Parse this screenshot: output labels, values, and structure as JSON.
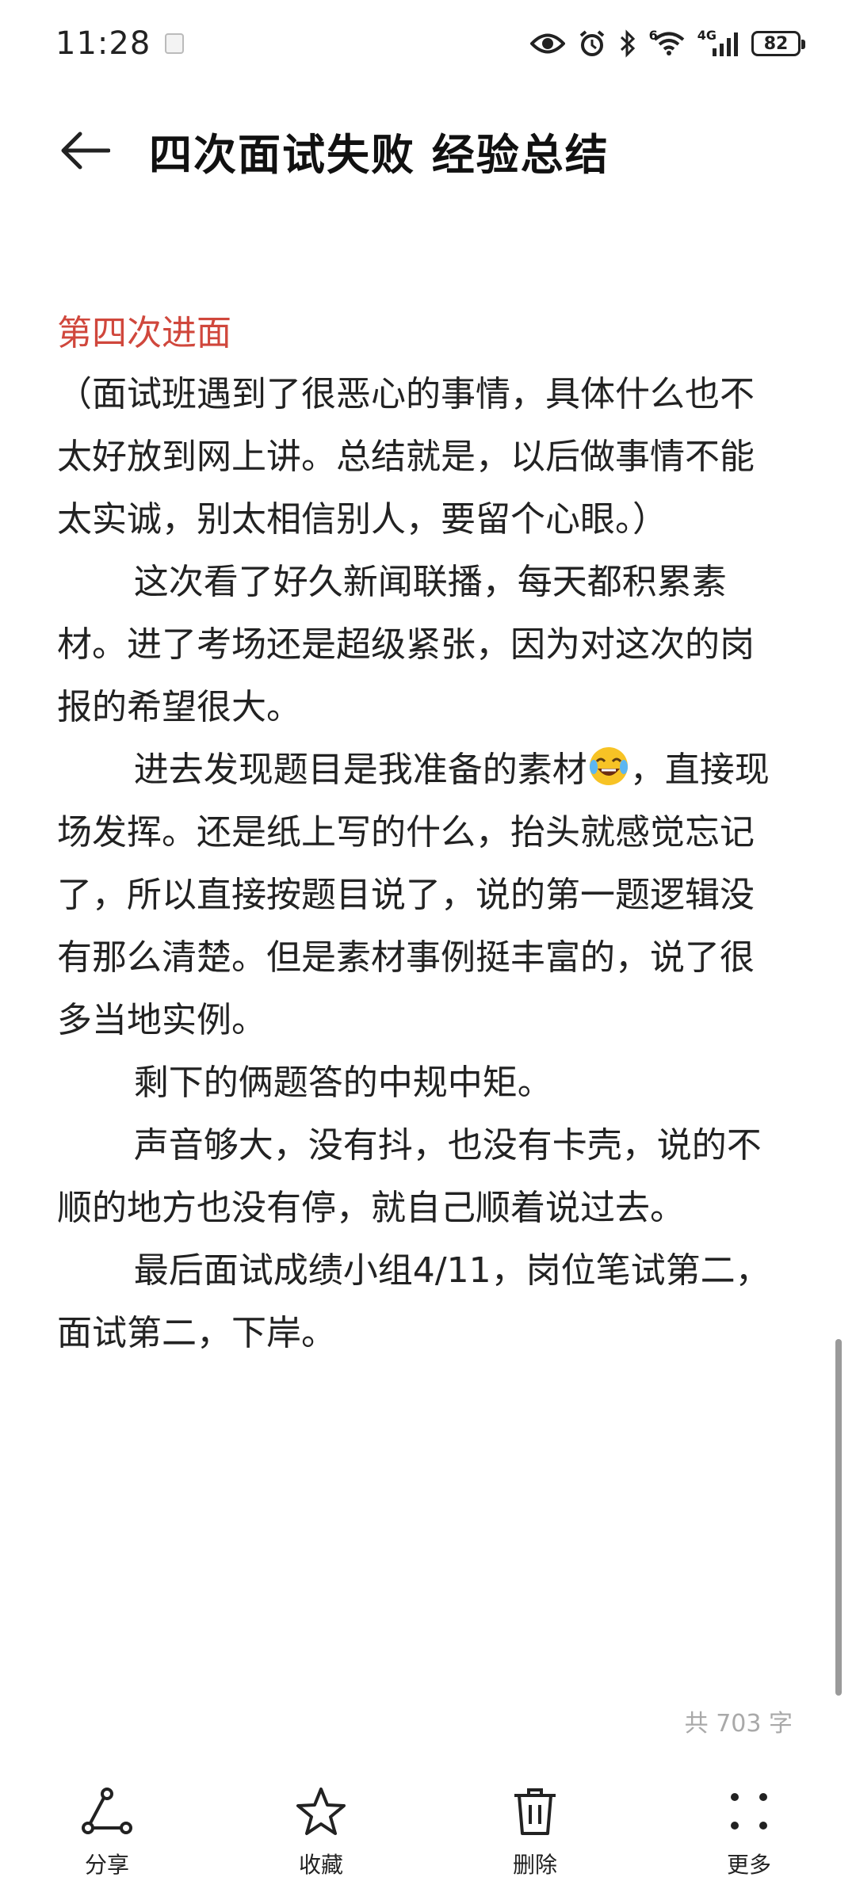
{
  "status_bar": {
    "time": "11:28",
    "network_label": "4G",
    "signal_superscript": "6",
    "battery": "82",
    "icons": [
      "eye-icon",
      "alarm-icon",
      "bluetooth-icon",
      "wifi-icon",
      "signal-icon",
      "battery-icon"
    ]
  },
  "header": {
    "title": "四次面试失败 经验总结",
    "back_icon": "back-arrow-icon"
  },
  "article": {
    "section_title": "第四次进面",
    "paragraphs": [
      "（面试班遇到了很恶心的事情，具体什么也不太好放到网上讲。总结就是，以后做事情不能太实诚，别太相信别人，要留个心眼。）",
      "这次看了好久新闻联播，每天都积累素材。进了考场还是超级紧张，因为对这次的岗报的希望很大。",
      "进去发现题目是我准备的素材",
      "，直接现场发挥。还是纸上写的什么，抬头就感觉忘记了，所以直接按题目说了，说的第一题逻辑没有那么清楚。但是素材事例挺丰富的，说了很多当地实例。",
      "剩下的俩题答的中规中矩。",
      "声音够大，没有抖，也没有卡壳，说的不顺的地方也没有停，就自己顺着说过去。",
      "最后面试成绩小组4/11，岗位笔试第二，面试第二，下岸。"
    ],
    "emoji_icon": "laughing-crying-emoji-icon"
  },
  "word_count": "共 703 字",
  "bottom_bar": {
    "share": "分享",
    "favorite": "收藏",
    "delete": "删除",
    "more": "更多"
  }
}
